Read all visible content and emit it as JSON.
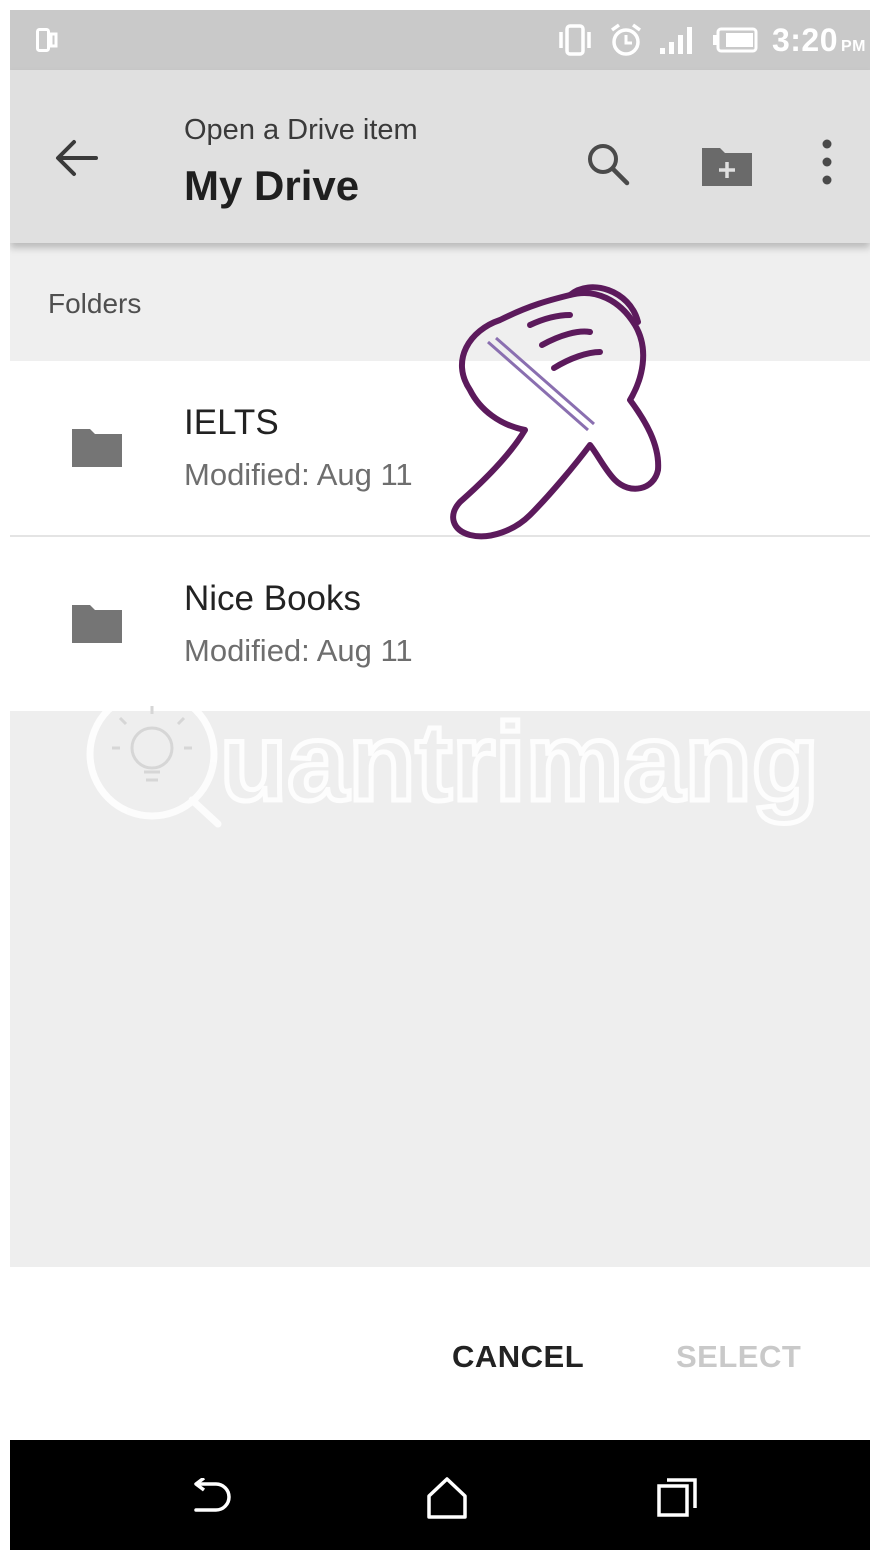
{
  "status_bar": {
    "time": "3:20",
    "ampm": "PM",
    "icons": [
      "screen-icon",
      "vibrate-icon",
      "alarm-icon",
      "signal-icon",
      "battery-icon"
    ]
  },
  "toolbar": {
    "subtitle": "Open a Drive item",
    "title": "My Drive",
    "icons": [
      "back-arrow-icon",
      "search-icon",
      "new-folder-icon",
      "more-vert-icon"
    ]
  },
  "section": {
    "label": "Folders"
  },
  "folders": [
    {
      "name": "IELTS",
      "modified": "Modified: Aug 11"
    },
    {
      "name": "Nice Books",
      "modified": "Modified: Aug 11"
    }
  ],
  "watermark": {
    "text": "uantrimang"
  },
  "actions": {
    "cancel": "CANCEL",
    "select": "SELECT"
  },
  "colors": {
    "status_bar": "#c9c9c9",
    "toolbar": "#e0e0e0",
    "list_background": "#eeeeee",
    "disabled_text": "#c9c9c9",
    "annotation": "#5c1a5c"
  },
  "nav_bar": {
    "icons": [
      "nav-back-icon",
      "nav-home-icon",
      "nav-recents-icon"
    ]
  }
}
